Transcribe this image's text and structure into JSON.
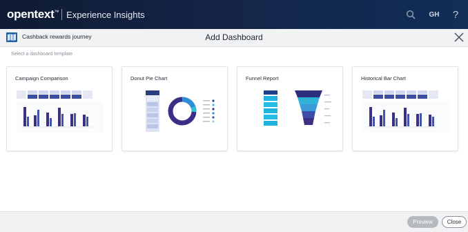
{
  "topbar": {
    "brand": "opentext",
    "brand_mark": "™",
    "product": "Experience Insights",
    "user_initials": "GH",
    "help": "?"
  },
  "dialog": {
    "journey_name": "Cashback rewards journey",
    "title": "Add Dashboard",
    "subtitle": "Select a dashboard template"
  },
  "templates": [
    {
      "title": "Campaign Comparison"
    },
    {
      "title": "Donut Pie Chart"
    },
    {
      "title": "Funnel Report"
    },
    {
      "title": "Historical Bar Chart"
    }
  ],
  "footer": {
    "preview_label": "Preview",
    "close_label": "Close"
  },
  "colors": {
    "topbar": "#13223f",
    "accent_dark": "#3d2f84",
    "accent_blue": "#2c4d9a",
    "accent_cyan": "#2fc3dc"
  }
}
